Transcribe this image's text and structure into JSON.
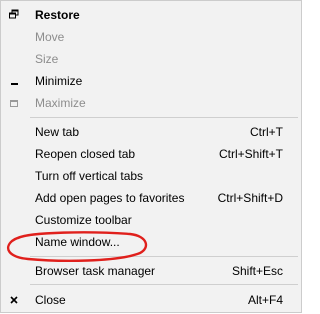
{
  "menu": {
    "items": [
      {
        "label": "Restore",
        "shortcut": "",
        "icon": "restore-icon"
      },
      {
        "label": "Move",
        "shortcut": ""
      },
      {
        "label": "Size",
        "shortcut": ""
      },
      {
        "label": "Minimize",
        "shortcut": "",
        "icon": "minimize-icon"
      },
      {
        "label": "Maximize",
        "shortcut": "",
        "icon": "maximize-icon"
      },
      {
        "label": "New tab",
        "shortcut": "Ctrl+T"
      },
      {
        "label": "Reopen closed tab",
        "shortcut": "Ctrl+Shift+T"
      },
      {
        "label": "Turn off vertical tabs",
        "shortcut": ""
      },
      {
        "label": "Add open pages to favorites",
        "shortcut": "Ctrl+Shift+D"
      },
      {
        "label": "Customize toolbar",
        "shortcut": ""
      },
      {
        "label": "Name window...",
        "shortcut": ""
      },
      {
        "label": "Browser task manager",
        "shortcut": "Shift+Esc"
      },
      {
        "label": "Close",
        "shortcut": "Alt+F4",
        "icon": "close-icon"
      }
    ]
  },
  "annotation": {
    "color": "#e0201c"
  }
}
